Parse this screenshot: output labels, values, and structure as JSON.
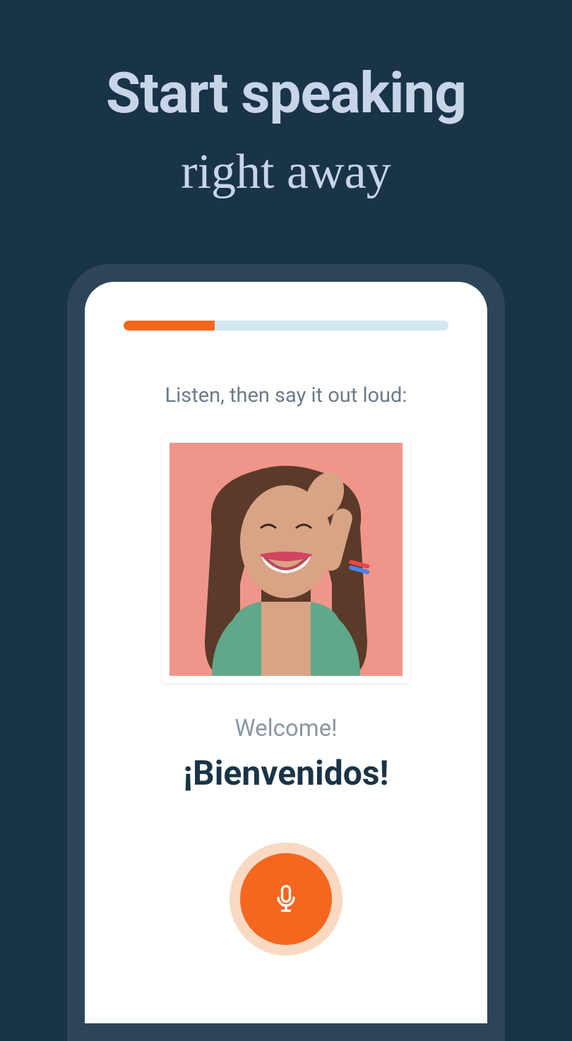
{
  "headline": {
    "bold": "Start speaking",
    "serif": "right away"
  },
  "lesson": {
    "progress_percent": 28,
    "instruction": "Listen, then say it out loud:",
    "translation": "Welcome!",
    "target_phrase": "¡Bienvenidos!"
  },
  "colors": {
    "background": "#1a3447",
    "accent": "#f5661e",
    "progress_track": "#d4e8f0",
    "headline_text": "#c8d4e8"
  }
}
